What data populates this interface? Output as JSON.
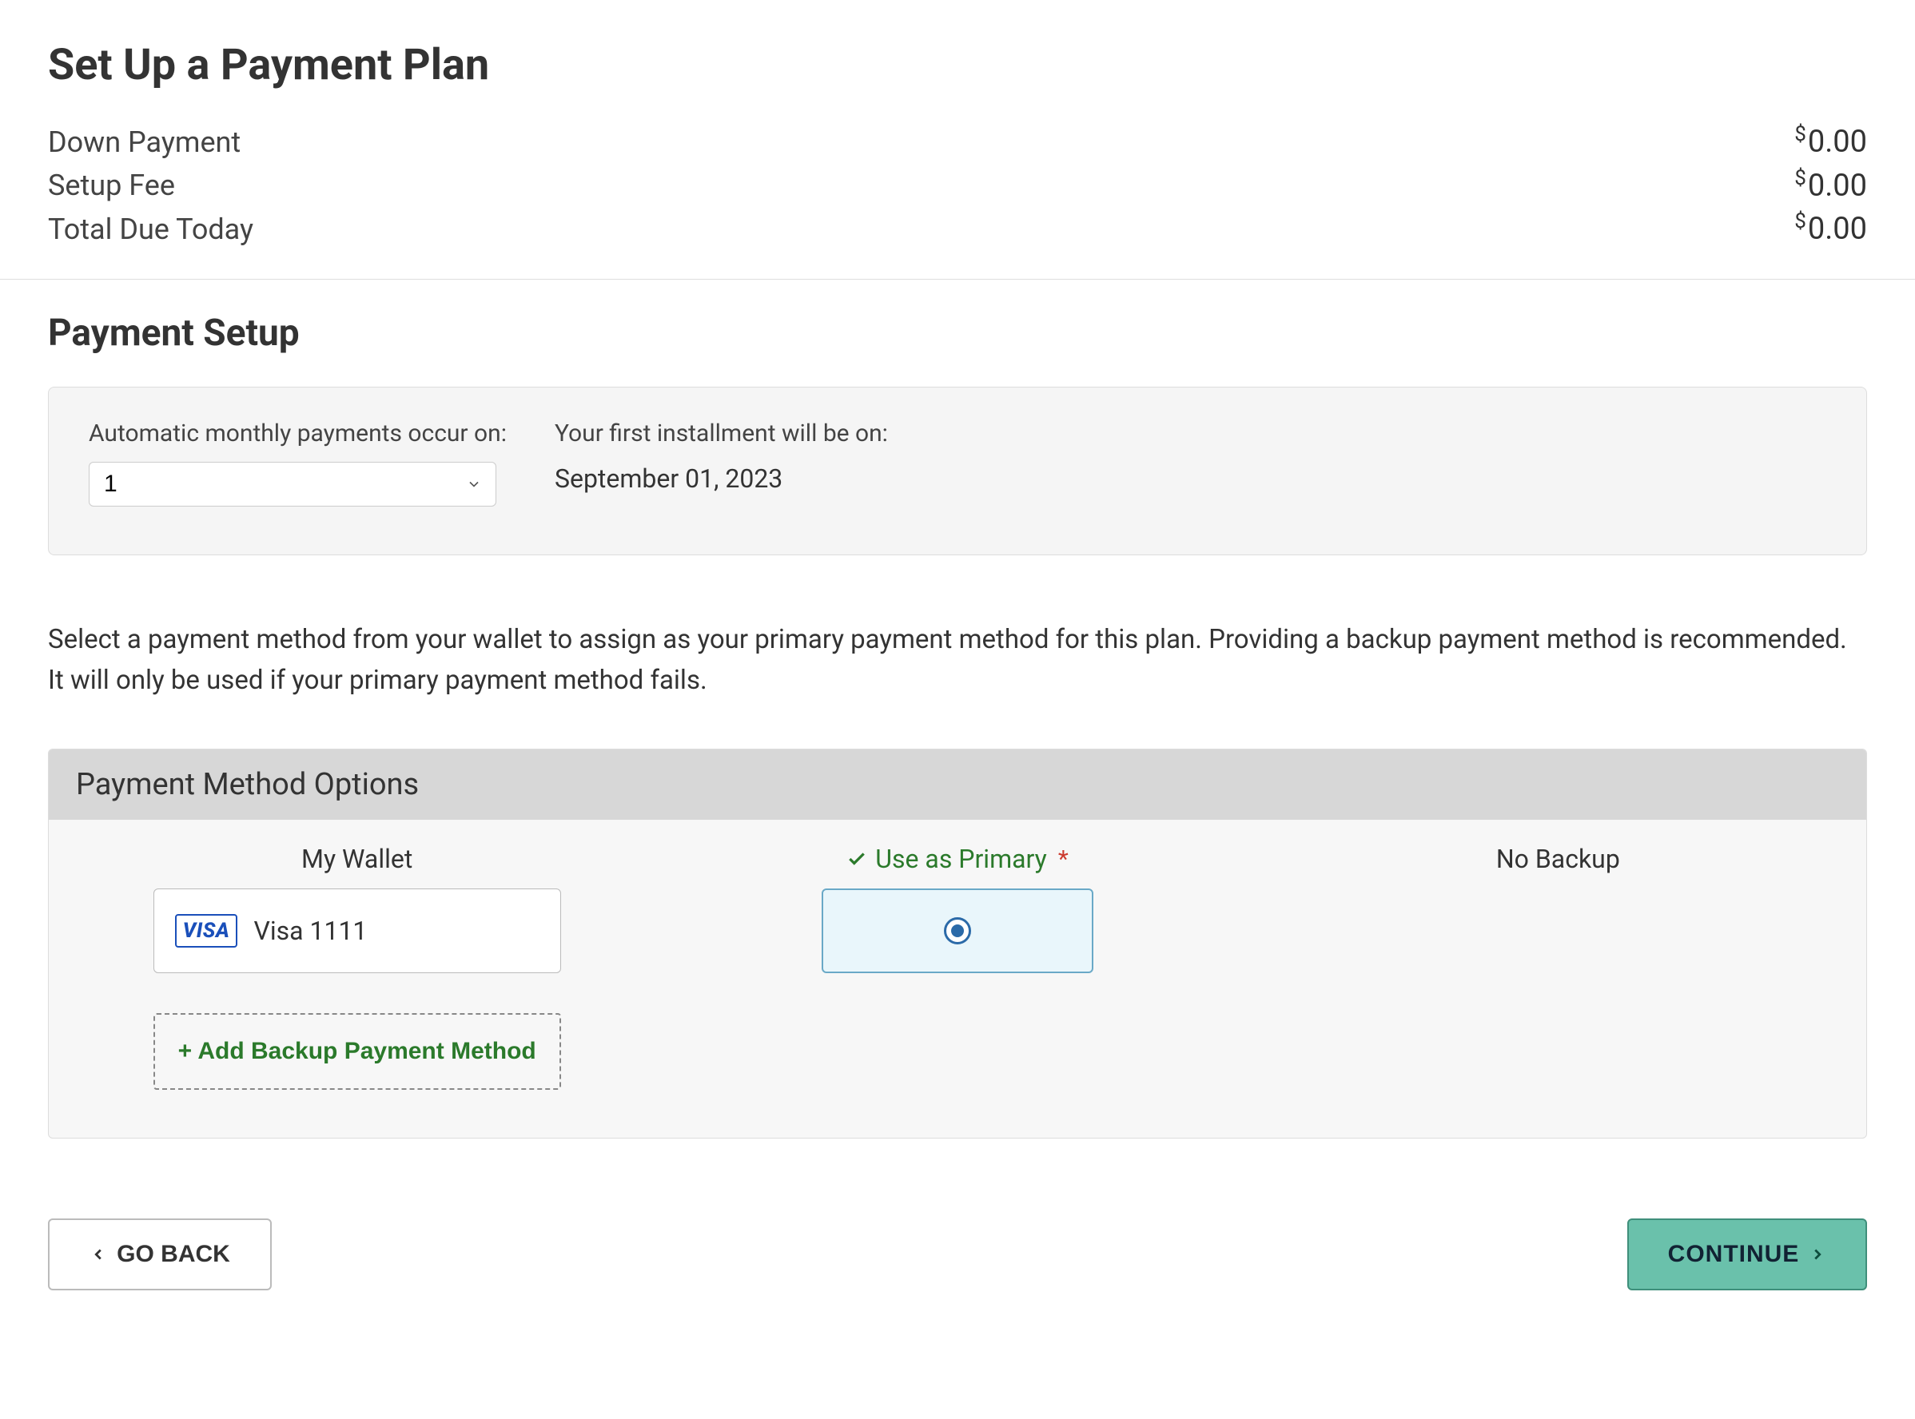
{
  "page": {
    "title": "Set Up a Payment Plan",
    "summary": {
      "down_payment_label": "Down Payment",
      "down_payment_amount": "0.00",
      "setup_fee_label": "Setup Fee",
      "setup_fee_amount": "0.00",
      "total_due_label": "Total Due Today",
      "total_due_amount": "0.00",
      "currency": "$"
    }
  },
  "setup": {
    "title": "Payment Setup",
    "auto_label": "Automatic monthly payments occur on:",
    "auto_day": "1",
    "first_label": "Your first installment will be on:",
    "first_date": "September 01, 2023"
  },
  "help_text": "Select a payment method from your wallet to assign as your primary payment method for this plan. Providing a backup payment method is recommended. It will only be used if your primary payment method fails.",
  "methods": {
    "header": "Payment Method Options",
    "wallet_col": "My Wallet",
    "primary_col": "Use as Primary",
    "backup_col": "No Backup",
    "card_brand": "VISA",
    "card_label": "Visa 1111",
    "add_backup": "+ Add Backup Payment Method"
  },
  "buttons": {
    "back": "GO BACK",
    "continue": "CONTINUE"
  }
}
